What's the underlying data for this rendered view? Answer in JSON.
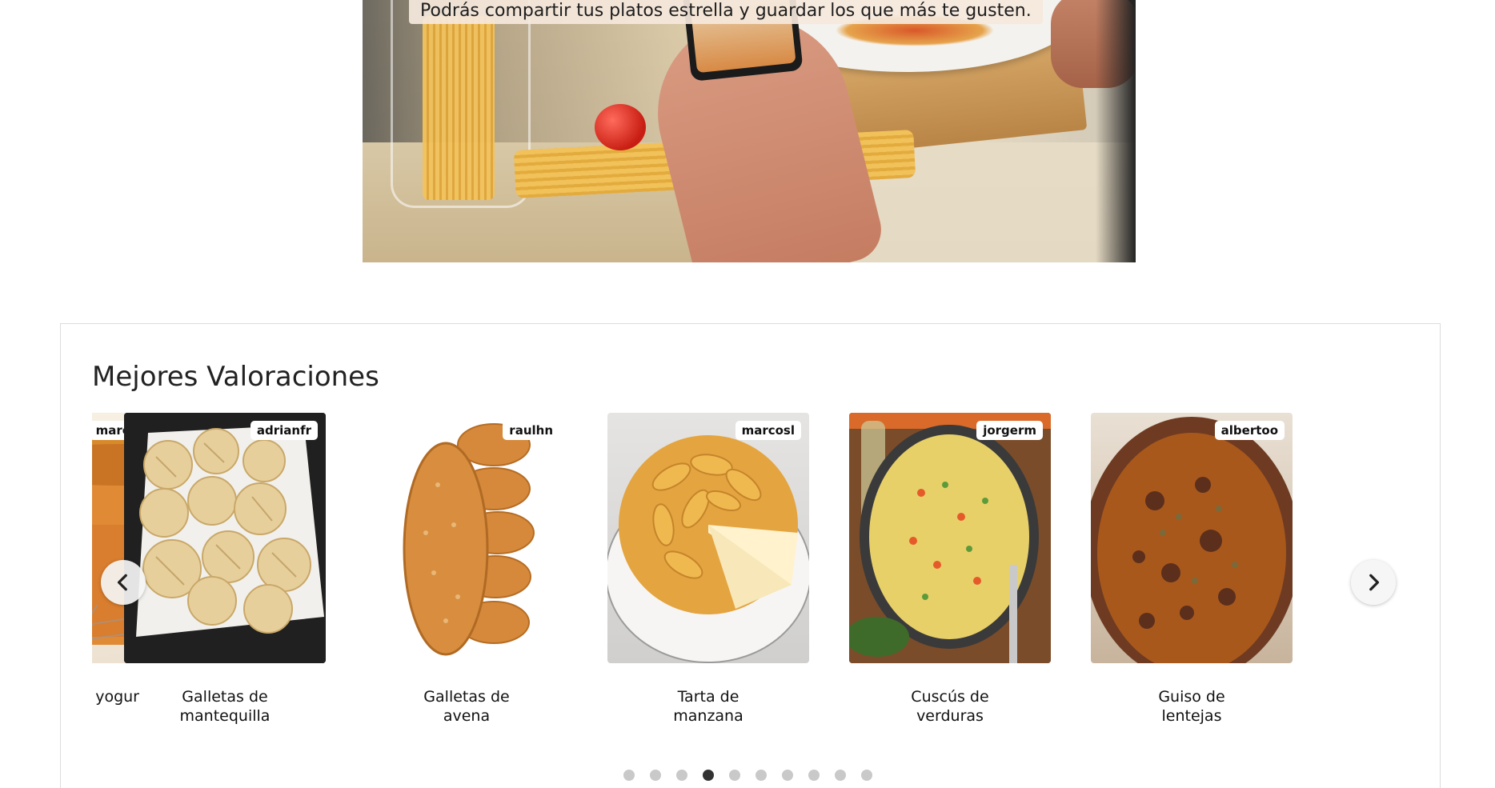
{
  "hero": {
    "caption": "Podrás compartir tus platos estrella y guardar los que más te gusten."
  },
  "section": {
    "title": "Mejores Valoraciones"
  },
  "cards": [
    {
      "user": "marcosl",
      "title": "Bizcocho de yogur",
      "visible_title": "ho de yogur",
      "image": "yogurt-cake"
    },
    {
      "user": "adrianfr",
      "title": "Galletas de mantequilla",
      "visible_title": "Galletas de mantequilla",
      "image": "butter-cookies"
    },
    {
      "user": "raulhn",
      "title": "Galletas de avena",
      "visible_title": "Galletas de avena",
      "image": "oat-cookies"
    },
    {
      "user": "marcosl",
      "title": "Tarta de manzana",
      "visible_title": "Tarta de manzana",
      "image": "apple-tart"
    },
    {
      "user": "jorgerm",
      "title": "Cuscús de verduras",
      "visible_title": "Cuscús de verduras",
      "image": "vegetable-couscous"
    },
    {
      "user": "albertoo",
      "title": "Guiso de lentejas",
      "visible_title": "Guiso de lentejas",
      "image": "lentil-stew"
    }
  ],
  "carousel": {
    "prev_icon": "chevron-left-icon",
    "next_icon": "chevron-right-icon",
    "dot_count": 10,
    "active_dot": 4
  }
}
